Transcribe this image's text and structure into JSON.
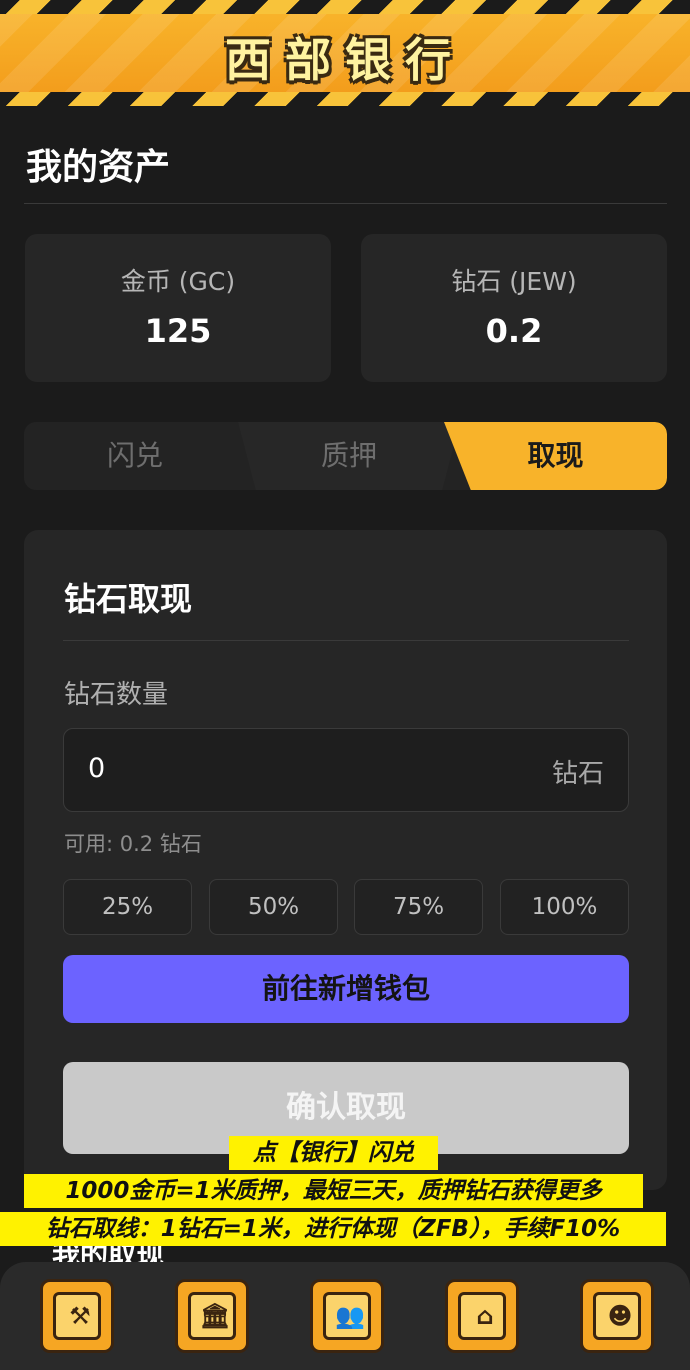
{
  "header": {
    "title": "西部银行"
  },
  "assets": {
    "title": "我的资产",
    "gold": {
      "label": "金币 (GC)",
      "value": "125"
    },
    "diamond": {
      "label": "钻石 (JEW)",
      "value": "0.2"
    }
  },
  "tabs": [
    {
      "label": "闪兑",
      "active": false
    },
    {
      "label": "质押",
      "active": false
    },
    {
      "label": "取现",
      "active": true
    }
  ],
  "withdraw": {
    "title": "钻石取现",
    "amount_label": "钻石数量",
    "amount_value": "0",
    "amount_unit": "钻石",
    "available": "可用: 0.2 钻石",
    "percentages": [
      "25%",
      "50%",
      "75%",
      "100%"
    ],
    "wallet_button": "前往新增钱包",
    "confirm_button": "确认取现"
  },
  "records": {
    "title": "我的取现"
  },
  "captions": [
    "点【银行】闪兑",
    "1000金币=1米质押，最短三天，质押钻石获得更多",
    "钻石取线：1钻石=1米，进行体现（ZFB），手续F10%"
  ],
  "nav": [
    {
      "label": "工作",
      "icon": "work-icon",
      "active": false
    },
    {
      "label": "银行",
      "icon": "bank-icon",
      "active": true
    },
    {
      "label": "团队",
      "icon": "team-icon",
      "active": false
    },
    {
      "label": "交易",
      "icon": "trade-icon",
      "active": false
    },
    {
      "label": "我的",
      "icon": "profile-icon",
      "active": false
    }
  ],
  "colors": {
    "accent": "#f6a623",
    "wallet_button": "#6c63ff",
    "caption_bg": "#fff200",
    "background": "#1b1b1b"
  }
}
